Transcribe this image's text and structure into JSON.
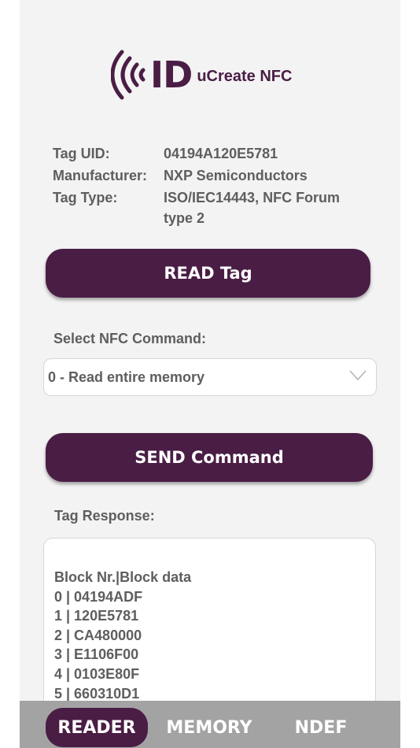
{
  "header": {
    "logo_mark": "ID",
    "app_name": "uCreate NFC"
  },
  "tag_info": {
    "uid_label": "Tag UID:",
    "uid_value": "04194A120E5781",
    "manufacturer_label": "Manufacturer:",
    "manufacturer_value": "NXP Semiconductors",
    "type_label": "Tag Type:",
    "type_value_line1": "ISO/IEC14443, NFC Forum",
    "type_value_line2": "type 2"
  },
  "read_button_label": "READ Tag",
  "command": {
    "label": "Select NFC Command:",
    "selected": "0 - Read entire memory"
  },
  "send_button_label": "SEND Command",
  "response": {
    "label": "Tag Response:",
    "lines": [
      "Block Nr.|Block data",
      "0 | 04194ADF",
      "1 | 120E5781",
      "2 | CA480000",
      "3 | E1106F00",
      "4 | 0103E80F",
      "5 | 660310D1"
    ]
  },
  "tabs": [
    {
      "label": "READER",
      "active": true
    },
    {
      "label": "MEMORY",
      "active": false
    },
    {
      "label": "NDEF",
      "active": false
    }
  ],
  "colors": {
    "brand": "#4a1d45",
    "background": "#f3f3f3",
    "tabbar": "#a3a3a3",
    "text": "#5e5e5e"
  }
}
